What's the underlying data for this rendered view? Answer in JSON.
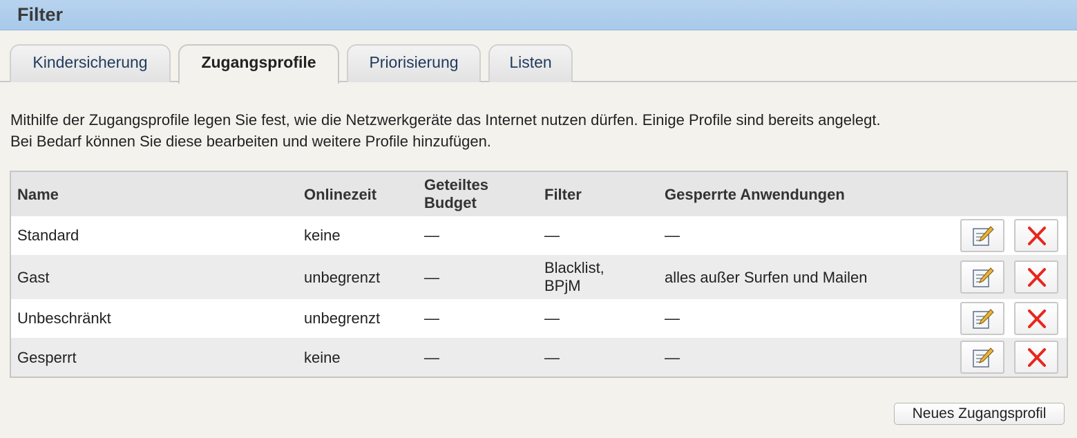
{
  "header": {
    "title": "Filter"
  },
  "tabs": [
    {
      "label": "Kindersicherung",
      "active": false
    },
    {
      "label": "Zugangsprofile",
      "active": true
    },
    {
      "label": "Priorisierung",
      "active": false
    },
    {
      "label": "Listen",
      "active": false
    }
  ],
  "intro": {
    "line1": "Mithilfe der Zugangsprofile legen Sie fest, wie die Netzwerkgeräte das Internet nutzen dürfen. Einige Profile sind bereits angelegt.",
    "line2": "Bei Bedarf können Sie diese bearbeiten und weitere Profile hinzufügen."
  },
  "table": {
    "headers": {
      "name": "Name",
      "onlinezeit": "Onlinezeit",
      "budget_line1": "Geteiltes",
      "budget_line2": "Budget",
      "filter": "Filter",
      "gesperrt": "Gesperrte Anwendungen"
    },
    "rows": [
      {
        "name": "Standard",
        "onlinezeit": "keine",
        "budget": "—",
        "filter_line1": "—",
        "filter_line2": "",
        "gesperrt": "—"
      },
      {
        "name": "Gast",
        "onlinezeit": "unbegrenzt",
        "budget": "—",
        "filter_line1": "Blacklist,",
        "filter_line2": "BPjM",
        "gesperrt": "alles außer Surfen und Mailen"
      },
      {
        "name": "Unbeschränkt",
        "onlinezeit": "unbegrenzt",
        "budget": "—",
        "filter_line1": "—",
        "filter_line2": "",
        "gesperrt": "—"
      },
      {
        "name": "Gesperrt",
        "onlinezeit": "keine",
        "budget": "—",
        "filter_line1": "—",
        "filter_line2": "",
        "gesperrt": "—"
      }
    ]
  },
  "actions": {
    "new_profile_label": "Neues Zugangsprofil"
  },
  "colors": {
    "header_bg": "#b7d3ee",
    "page_bg": "#f4f2ed",
    "delete_red": "#e8261c"
  },
  "icons": {
    "edit": "edit-icon",
    "delete": "delete-icon"
  }
}
